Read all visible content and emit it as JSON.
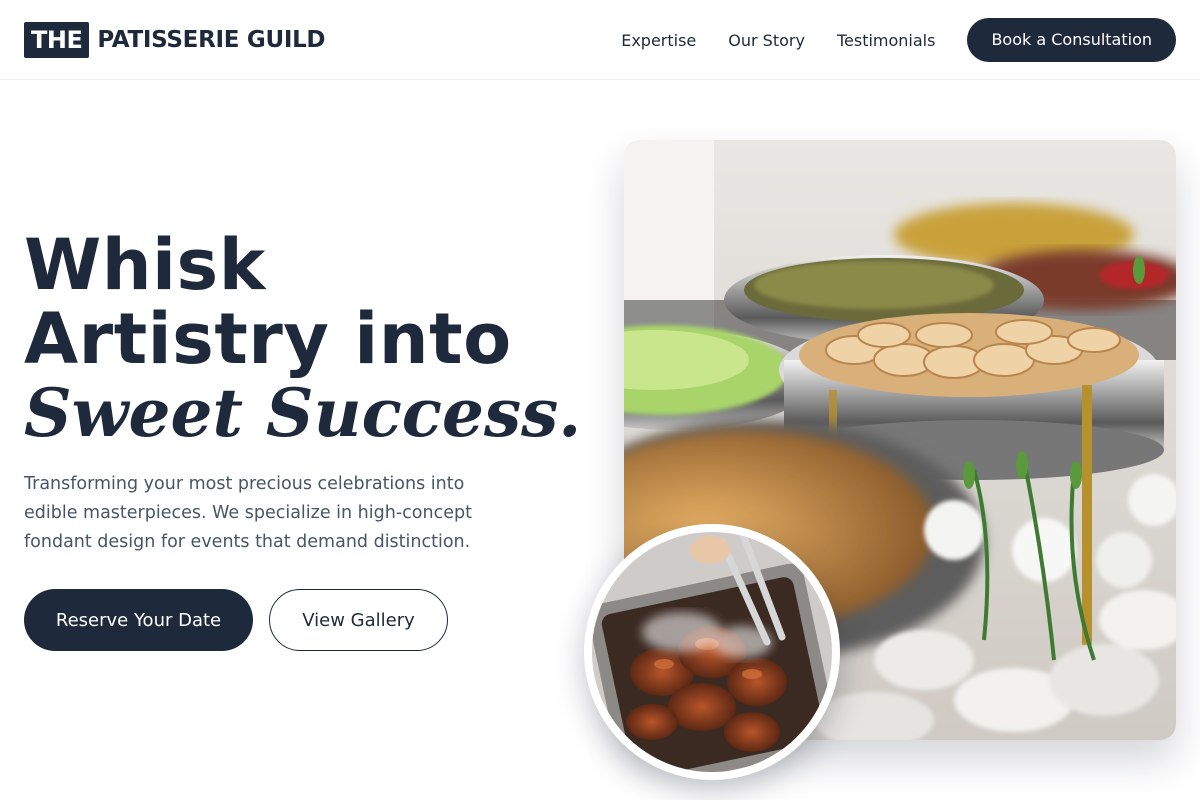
{
  "brand": {
    "badge": "THE",
    "name": "PATISSERIE GUILD"
  },
  "nav": {
    "links": [
      "Expertise",
      "Our Story",
      "Testimonials"
    ],
    "cta": "Book a Consultation"
  },
  "hero": {
    "line1": "Whisk",
    "line2": "Artistry into",
    "line3": "Sweet Success.",
    "description": "Transforming your most precious celebrations into edible masterpieces. We specialize in high-concept fondant design for events that demand distinction.",
    "primary_button": "Reserve Your Date",
    "secondary_button": "View Gallery"
  },
  "images": {
    "main": "catering-buffet-chafing-dishes-photo",
    "inset": "grilled-meat-with-tongs-photo"
  }
}
